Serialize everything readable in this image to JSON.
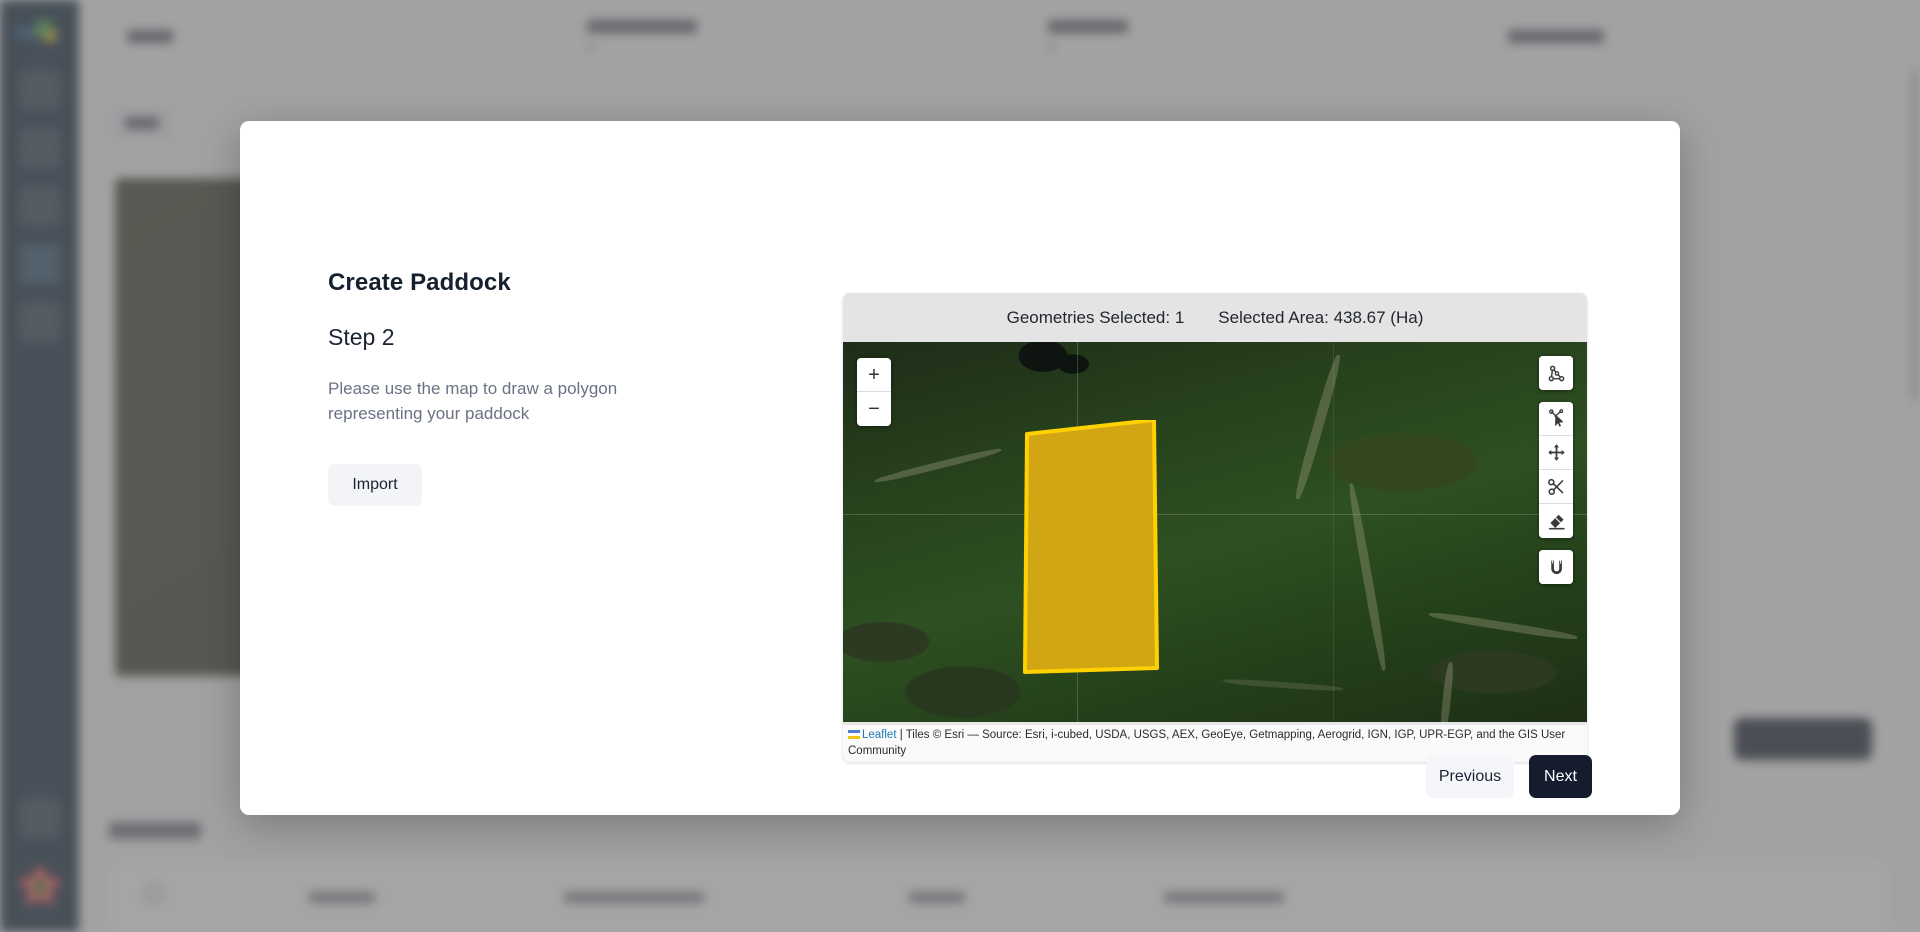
{
  "modal": {
    "title": "Create Paddock",
    "close_icon": "close-icon",
    "step_label": "Step 2",
    "description": "Please use the map to draw a polygon representing your paddock",
    "import_label": "Import",
    "previous_label": "Previous",
    "next_label": "Next"
  },
  "map": {
    "geometries_selected": "Geometries Selected: 1",
    "selected_area": "Selected Area: 438.67 (Ha)",
    "zoom_in": "+",
    "zoom_out": "−",
    "attribution_prefix": "Leaflet",
    "attribution_text": " | Tiles © Esri — Source: Esri, i-cubed, USDA, USGS, AEX, GeoEye, Getmapping, Aerogrid, IGN, IGP, UPR-EGP, and the GIS User Community",
    "tools": [
      {
        "name": "draw-polygon-icon",
        "label": "Draw polygon"
      },
      {
        "name": "edit-vertices-icon",
        "label": "Edit vertices"
      },
      {
        "name": "move-geometry-icon",
        "label": "Move geometry"
      },
      {
        "name": "cut-geometry-icon",
        "label": "Cut geometry"
      },
      {
        "name": "erase-geometry-icon",
        "label": "Erase geometry"
      },
      {
        "name": "magnet-snap-icon",
        "label": "Snapping"
      }
    ],
    "polygon_fill": "#dfae14",
    "polygon_stroke": "#ffd100"
  },
  "theme": {
    "accent_dark": "#151c2e",
    "button_light": "#f4f6fa",
    "text_muted": "#6a7284",
    "scrim": "rgba(110,110,110,0.62)"
  }
}
